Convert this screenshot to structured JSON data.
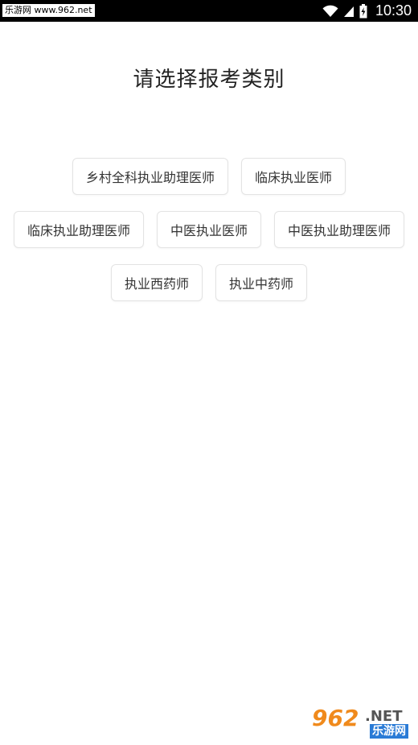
{
  "status_bar": {
    "watermark": "乐游网 www.962.net",
    "time": "10:30",
    "icons": [
      "wifi-icon",
      "cellular-signal-icon",
      "battery-charging-icon"
    ]
  },
  "title": "请选择报考类别",
  "options": {
    "row1": [
      "乡村全科执业助理医师",
      "临床执业医师"
    ],
    "row2": [
      "临床执业助理医师",
      "中医执业医师",
      "中医执业助理医师"
    ],
    "row3": [
      "执业西药师",
      "执业中药师"
    ]
  },
  "watermark_logo": {
    "number": "962",
    "suffix": ".NET",
    "chinese": "乐游网"
  },
  "colors": {
    "status_bar_bg": "#000000",
    "title_text": "#222222",
    "button_border": "#e3e3e3",
    "button_text": "#333333",
    "logo_orange": "#f08a1c",
    "logo_blue": "#2a7bd6"
  }
}
